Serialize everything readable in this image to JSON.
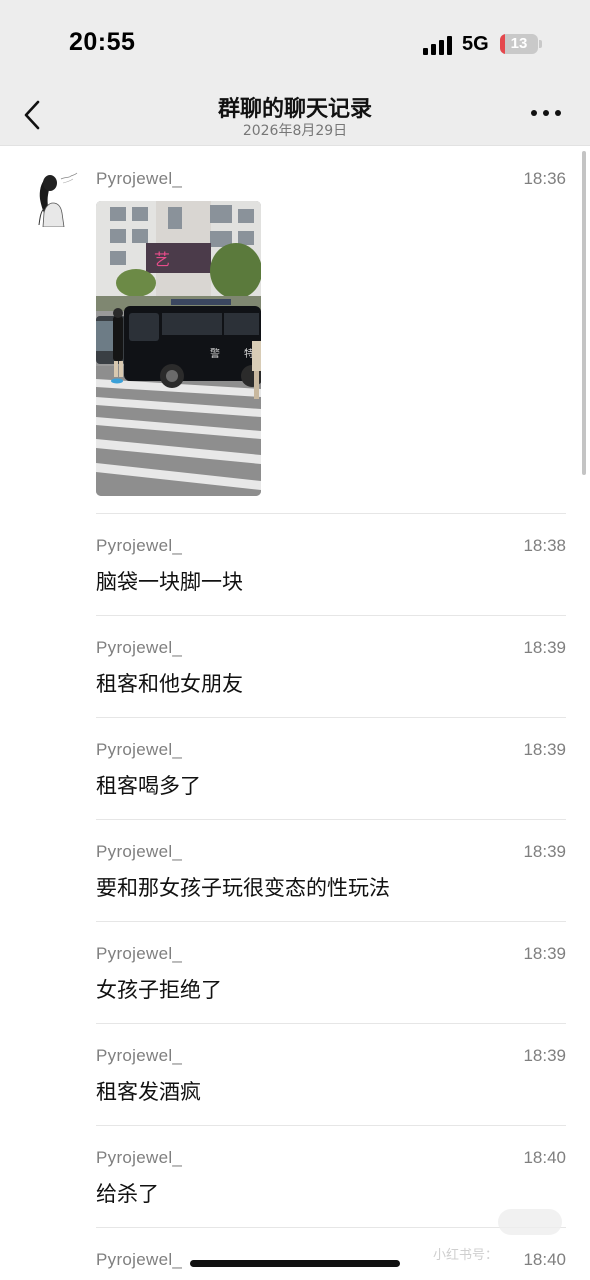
{
  "status_bar": {
    "time": "20:55",
    "network": "5G",
    "battery": "13",
    "battery_level": 0.13
  },
  "nav": {
    "title": "群聊的聊天记录",
    "subtitle": "2026年8月29日",
    "back_icon": "chevron-left-icon",
    "more_icon": "more-dots-icon"
  },
  "photo": {
    "van_label_1": "警",
    "van_label_2": "特",
    "sign_text": "艺"
  },
  "messages": [
    {
      "sender": "Pyrojewel_",
      "time": "18:36",
      "type": "image"
    },
    {
      "sender": "Pyrojewel_",
      "time": "18:38",
      "text": "脑袋一块脚一块"
    },
    {
      "sender": "Pyrojewel_",
      "time": "18:39",
      "text": "租客和他女朋友"
    },
    {
      "sender": "Pyrojewel_",
      "time": "18:39",
      "text": "租客喝多了"
    },
    {
      "sender": "Pyrojewel_",
      "time": "18:39",
      "text": "要和那女孩子玩很变态的性玩法"
    },
    {
      "sender": "Pyrojewel_",
      "time": "18:39",
      "text": "女孩子拒绝了"
    },
    {
      "sender": "Pyrojewel_",
      "time": "18:39",
      "text": "租客发酒疯"
    },
    {
      "sender": "Pyrojewel_",
      "time": "18:40",
      "text": "给杀了"
    },
    {
      "sender": "Pyrojewel_",
      "time": "18:40"
    }
  ],
  "watermark": "小红书号：",
  "colors": {
    "chrome_bg": "#ededed",
    "meta_text": "#7f7f7f",
    "battery_low": "#e5484d"
  }
}
